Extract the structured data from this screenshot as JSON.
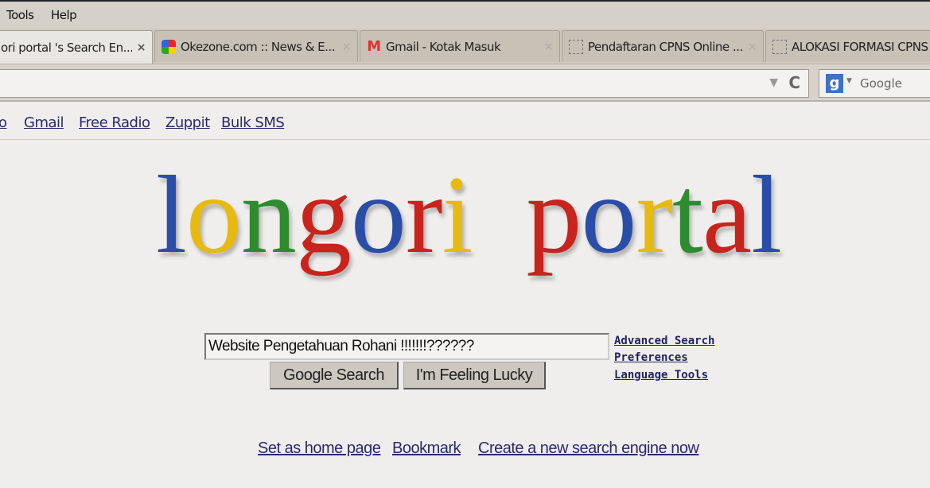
{
  "menu": {
    "tools": "Tools",
    "help": "Help"
  },
  "tabs": [
    {
      "title": "ori portal 's Search En...",
      "close": "×",
      "icon": "page-icon"
    },
    {
      "title": "Okezone.com :: News & E...",
      "close": "×",
      "icon": "okezone-icon"
    },
    {
      "title": "Gmail - Kotak Masuk",
      "close": "×",
      "icon": "gmail-icon"
    },
    {
      "title": "Pendaftaran CPNS Online ...",
      "close": "×",
      "icon": "blank-page-icon"
    },
    {
      "title": "ALOKASI FORMASI CPNS",
      "close": "×",
      "icon": "blank-page-icon"
    }
  ],
  "navbar": {
    "url": "",
    "search_placeholder": "Google",
    "search_engine_icon": "g"
  },
  "bookmarks": [
    "o",
    "Gmail",
    "Free Radio",
    "Zuppit",
    "Bulk SMS"
  ],
  "logo": {
    "letters": [
      {
        "c": "l",
        "color": "#2a4ea8"
      },
      {
        "c": "o",
        "color": "#e8b90f"
      },
      {
        "c": "n",
        "color": "#2e8b30"
      },
      {
        "c": "g",
        "color": "#c8231c"
      },
      {
        "c": "o",
        "color": "#2a4ea8"
      },
      {
        "c": "r",
        "color": "#c8231c"
      },
      {
        "c": "i",
        "color": "#e8b90f"
      },
      {
        "c": " ",
        "color": "#000"
      },
      {
        "c": "p",
        "color": "#c8231c"
      },
      {
        "c": "o",
        "color": "#2a4ea8"
      },
      {
        "c": "r",
        "color": "#e8b90f"
      },
      {
        "c": "t",
        "color": "#2e8b30"
      },
      {
        "c": "a",
        "color": "#c8231c"
      },
      {
        "c": "l",
        "color": "#2a4ea8"
      }
    ],
    "text": "longori portal"
  },
  "search": {
    "value": "Website Pengetahuan Rohani !!!!!!!??????",
    "google_search": "Google Search",
    "lucky": "I'm Feeling Lucky"
  },
  "side_links": {
    "advanced": "Advanced Search",
    "preferences": "Preferences",
    "language": "Language Tools"
  },
  "footer": {
    "home": "Set as home page",
    "bookmark": "Bookmark",
    "create": "Create a new search engine now"
  }
}
